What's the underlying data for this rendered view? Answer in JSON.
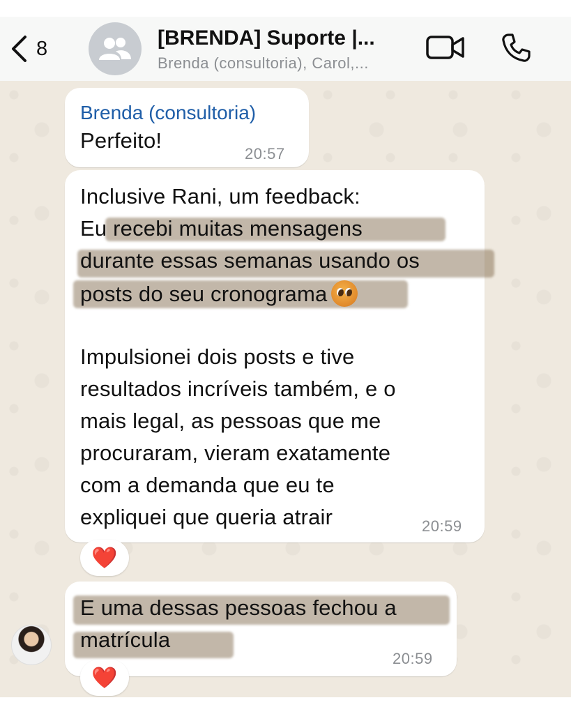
{
  "header": {
    "back_count": "8",
    "title": "[BRENDA] Suporte |...",
    "subtitle": "Brenda (consultoria), Carol,..."
  },
  "messages": [
    {
      "sender": "Brenda (consultoria)",
      "lines": [
        "Perfeito!"
      ],
      "time": "20:57"
    },
    {
      "lines": [
        "Inclusive Rani, um feedback:",
        "Eu recebi muitas mensagens",
        "durante essas semanas usando os",
        "posts do seu cronograma",
        "",
        "Impulsionei dois posts e tive",
        "resultados incríveis também, e o",
        "mais legal, as pessoas que me",
        "procuraram, vieram exatamente",
        "com a demanda que eu te",
        "expliquei que queria atrair"
      ],
      "time": "20:59",
      "reaction": "❤️"
    },
    {
      "lines": [
        "E uma dessas pessoas fechou a",
        "matrícula"
      ],
      "time": "20:59",
      "reaction": "❤️"
    }
  ],
  "icons": {
    "emoji": "pleading-face-icon",
    "reaction": "red-heart-icon"
  },
  "colors": {
    "chat_background": "#efe9df",
    "sender_name": "#1f5ea8",
    "highlight": "#8a7055"
  }
}
